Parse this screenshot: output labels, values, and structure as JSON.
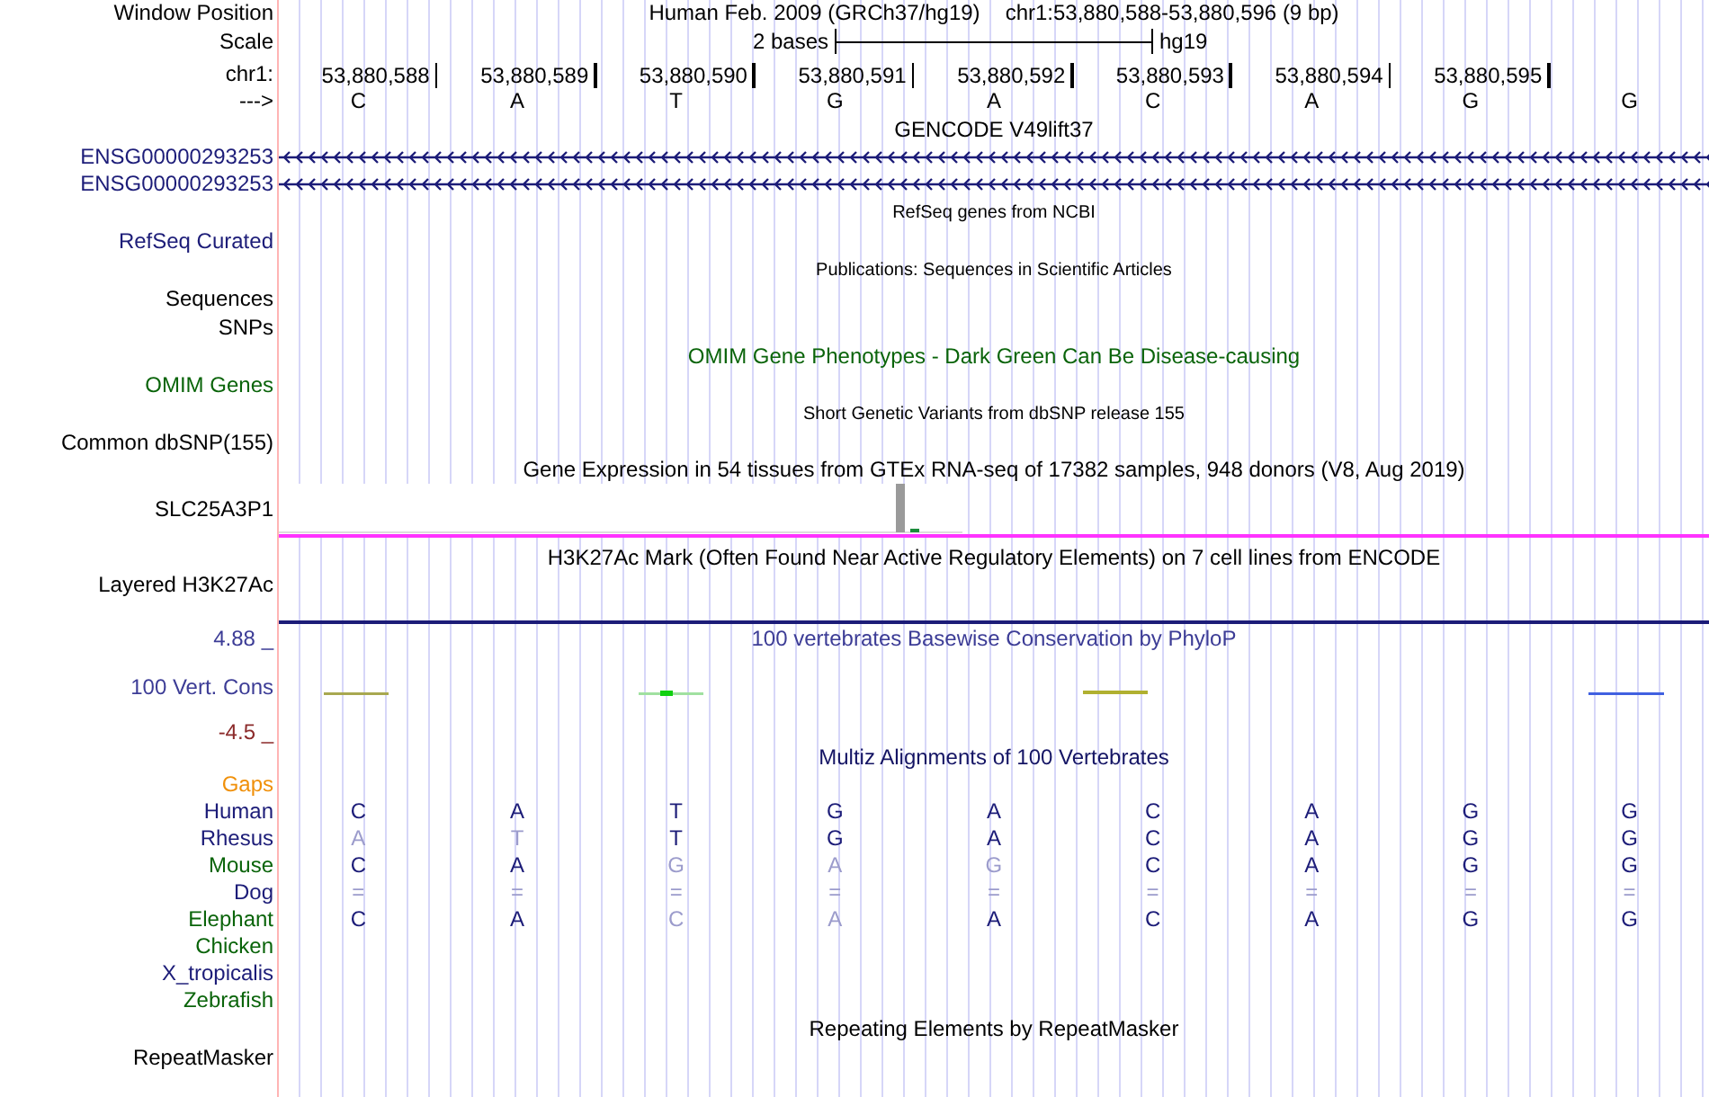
{
  "position": {
    "label": "Window Position",
    "assembly": "Human Feb. 2009 (GRCh37/hg19)",
    "range": "chr1:53,880,588-53,880,596 (9 bp)"
  },
  "scale": {
    "label": "Scale",
    "length": "2 bases",
    "assembly": "hg19"
  },
  "ruler": {
    "label": "chr1:",
    "positions": [
      "53,880,588",
      "53,880,589",
      "53,880,590",
      "53,880,591",
      "53,880,592",
      "53,880,593",
      "53,880,594",
      "53,880,595"
    ]
  },
  "sequence": {
    "label": "--->",
    "bases": [
      "C",
      "A",
      "T",
      "G",
      "A",
      "C",
      "A",
      "G",
      "G"
    ]
  },
  "tracks": [
    {
      "kind": "genes",
      "title": "GENCODE V49lift37",
      "color": "#000000",
      "genes": [
        {
          "text": "ENSG00000293253",
          "color": "#1c1c78"
        },
        {
          "text": "ENSG00000293253",
          "color": "#1c1c78"
        }
      ]
    },
    {
      "kind": "compact",
      "title": "RefSeq genes from NCBI",
      "color": "#000000",
      "labels": [
        {
          "text": "RefSeq Curated",
          "color": "#1c1c78"
        }
      ]
    },
    {
      "kind": "compact",
      "title": "Publications: Sequences in Scientific Articles",
      "color": "#000000",
      "labels": [
        {
          "text": "Sequences",
          "color": "#000000"
        },
        {
          "text": "SNPs",
          "color": "#000000"
        }
      ]
    },
    {
      "kind": "compact_large",
      "title": "OMIM Gene Phenotypes - Dark Green Can Be Disease-causing",
      "color": "#0a640a",
      "labels": [
        {
          "text": "OMIM Genes",
          "color": "#0a640a"
        }
      ]
    },
    {
      "kind": "compact",
      "title": "Short Genetic Variants from dbSNP release 155",
      "color": "#000000",
      "labels": [
        {
          "text": "Common dbSNP(155)",
          "color": "#000000"
        }
      ]
    },
    {
      "kind": "expression",
      "title": "Gene Expression in 54 tissues from GTEx RNA-seq of 17382 samples, 948 donors (V8, Aug 2019)",
      "color": "#000000",
      "labels": [
        {
          "text": "SLC25A3P1",
          "color": "#000000"
        }
      ]
    },
    {
      "kind": "full",
      "title": "H3K27Ac Mark (Often Found Near Active Regulatory Elements) on 7 cell lines from ENCODE",
      "color": "#000000",
      "labels": [
        {
          "text": "Layered H3K27Ac",
          "color": "#000000"
        }
      ]
    },
    {
      "kind": "conservation",
      "title": "100 vertebrates Basewise Conservation by PhyloP",
      "color": "#3c3c96",
      "labels": [
        {
          "text": "4.88 _",
          "color": "#3c3c96"
        },
        {
          "text": "100 Vert. Cons",
          "color": "#3c3c96"
        },
        {
          "text": "-4.5 _",
          "color": "#8b2a2a"
        }
      ]
    },
    {
      "kind": "alignment",
      "title": "Multiz Alignments of 100 Vertebrates",
      "color": "#141464",
      "labels": [
        {
          "text": "Gaps",
          "color": "#f0900a"
        }
      ],
      "species": [
        {
          "name": "Human",
          "color": "#1c1c78",
          "bases": [
            {
              "text": "C",
              "faded": false
            },
            {
              "text": "A",
              "faded": false
            },
            {
              "text": "T",
              "faded": false
            },
            {
              "text": "G",
              "faded": false
            },
            {
              "text": "A",
              "faded": false
            },
            {
              "text": "C",
              "faded": false
            },
            {
              "text": "A",
              "faded": false
            },
            {
              "text": "G",
              "faded": false
            },
            {
              "text": "G",
              "faded": false
            }
          ]
        },
        {
          "name": "Rhesus",
          "color": "#1c1c78",
          "bases": [
            {
              "text": "A",
              "faded": true
            },
            {
              "text": "T",
              "faded": true
            },
            {
              "text": "T",
              "faded": false
            },
            {
              "text": "G",
              "faded": false
            },
            {
              "text": "A",
              "faded": false
            },
            {
              "text": "C",
              "faded": false
            },
            {
              "text": "A",
              "faded": false
            },
            {
              "text": "G",
              "faded": false
            },
            {
              "text": "G",
              "faded": false
            }
          ]
        },
        {
          "name": "Mouse",
          "color": "#0a640a",
          "bases": [
            {
              "text": "C",
              "faded": false
            },
            {
              "text": "A",
              "faded": false
            },
            {
              "text": "G",
              "faded": true
            },
            {
              "text": "A",
              "faded": true
            },
            {
              "text": "G",
              "faded": true
            },
            {
              "text": "C",
              "faded": false
            },
            {
              "text": "A",
              "faded": false
            },
            {
              "text": "G",
              "faded": false
            },
            {
              "text": "G",
              "faded": false
            }
          ]
        },
        {
          "name": "Dog",
          "color": "#1c1c78",
          "bases": [
            {
              "text": "=",
              "faded": true
            },
            {
              "text": "=",
              "faded": true
            },
            {
              "text": "=",
              "faded": true
            },
            {
              "text": "=",
              "faded": true
            },
            {
              "text": "=",
              "faded": true
            },
            {
              "text": "=",
              "faded": true
            },
            {
              "text": "=",
              "faded": true
            },
            {
              "text": "=",
              "faded": true
            },
            {
              "text": "=",
              "faded": true
            }
          ]
        },
        {
          "name": "Elephant",
          "color": "#0a640a",
          "bases": [
            {
              "text": "C",
              "faded": false
            },
            {
              "text": "A",
              "faded": false
            },
            {
              "text": "C",
              "faded": true
            },
            {
              "text": "A",
              "faded": true
            },
            {
              "text": "A",
              "faded": false
            },
            {
              "text": "C",
              "faded": false
            },
            {
              "text": "A",
              "faded": false
            },
            {
              "text": "G",
              "faded": false
            },
            {
              "text": "G",
              "faded": false
            }
          ]
        },
        {
          "name": "Chicken",
          "color": "#0a640a"
        },
        {
          "name": "X_tropicalis",
          "color": "#1c1c78"
        },
        {
          "name": "Zebrafish",
          "color": "#0a640a"
        }
      ]
    },
    {
      "kind": "full_compact",
      "title": "Repeating Elements by RepeatMasker",
      "color": "#000000",
      "labels": [
        {
          "text": "RepeatMasker",
          "color": "#000000"
        }
      ]
    }
  ]
}
